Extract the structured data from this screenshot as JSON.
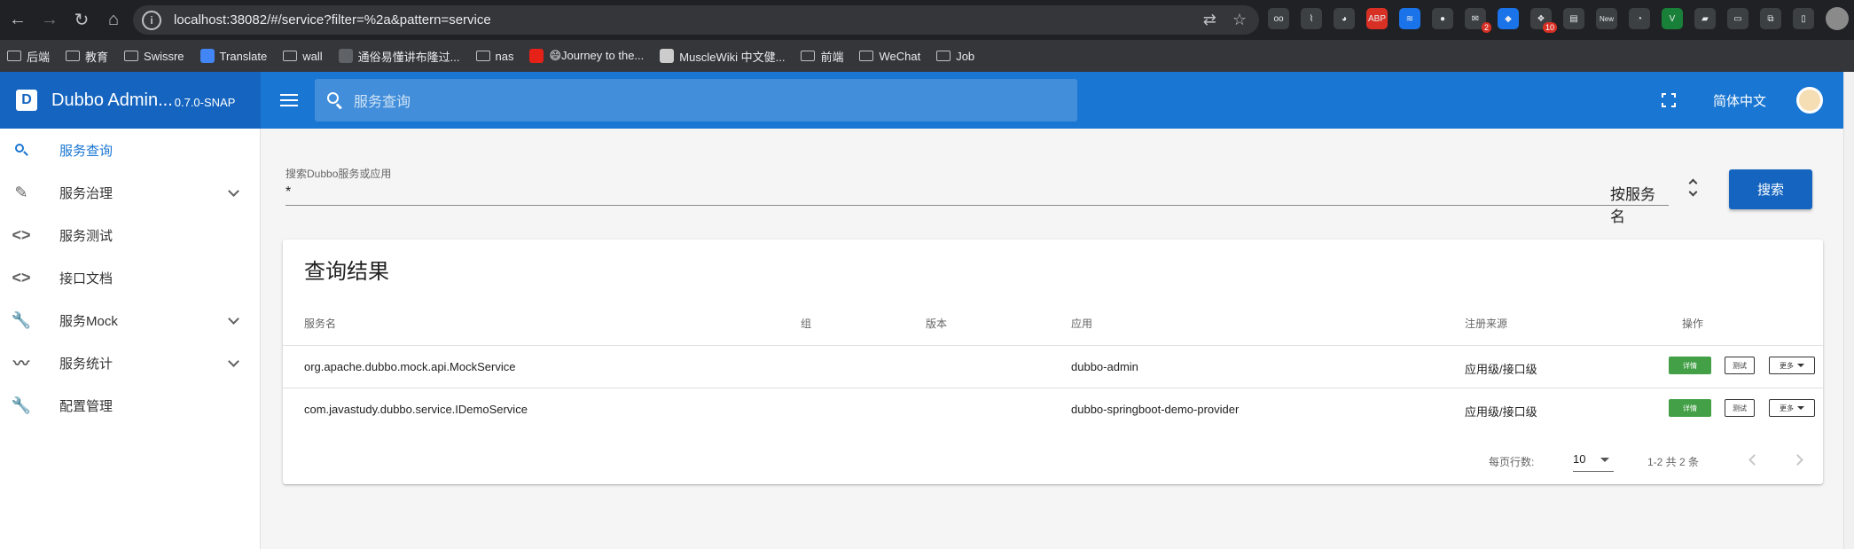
{
  "browser": {
    "url": "localhost:38082/#/service?filter=%2a&pattern=service",
    "extension_badges": [
      "2",
      "10",
      "New"
    ],
    "bookmarks": [
      "后端",
      "教育",
      "Swissre",
      "Translate",
      "wall",
      "通俗易懂讲布隆过...",
      "nas",
      "😄Journey to the...",
      "MuscleWiki 中文健...",
      "前端",
      "WeChat",
      "Job"
    ]
  },
  "app": {
    "title": "Dubbo Admin...",
    "version": "0.7.0-SNAP",
    "search_placeholder": "服务查询",
    "language": "简体中文"
  },
  "sidebar": {
    "items": [
      {
        "label": "服务查询",
        "icon": "search-icon",
        "active": true
      },
      {
        "label": "服务治理",
        "icon": "pencil-icon",
        "expandable": true
      },
      {
        "label": "服务测试",
        "icon": "code-icon"
      },
      {
        "label": "接口文档",
        "icon": "code-icon"
      },
      {
        "label": "服务Mock",
        "icon": "wrench-icon",
        "expandable": true
      },
      {
        "label": "服务统计",
        "icon": "trending-icon",
        "expandable": true
      },
      {
        "label": "配置管理",
        "icon": "wrench-icon"
      }
    ]
  },
  "search": {
    "label": "搜索Dubbo服务或应用",
    "value": "*",
    "mode": "按服务名",
    "button": "搜索"
  },
  "results": {
    "title": "查询结果",
    "columns": [
      "服务名",
      "组",
      "版本",
      "应用",
      "注册来源",
      "操作"
    ],
    "rows": [
      {
        "service": "org.apache.dubbo.mock.api.MockService",
        "group": "",
        "version": "",
        "application": "dubbo-admin",
        "source": "应用级/接口级"
      },
      {
        "service": "com.javastudy.dubbo.service.IDemoService",
        "group": "",
        "version": "",
        "application": "dubbo-springboot-demo-provider",
        "source": "应用级/接口级"
      }
    ],
    "actions": {
      "detail": "详情",
      "test": "测试",
      "more": "更多"
    },
    "footer": {
      "rows_per_page_label": "每页行数:",
      "rows_per_page": "10",
      "page_info": "1-2 共 2 条"
    }
  },
  "colors": {
    "primary": "#1976d2",
    "primary_dark": "#1565c0",
    "success": "#43a047"
  }
}
